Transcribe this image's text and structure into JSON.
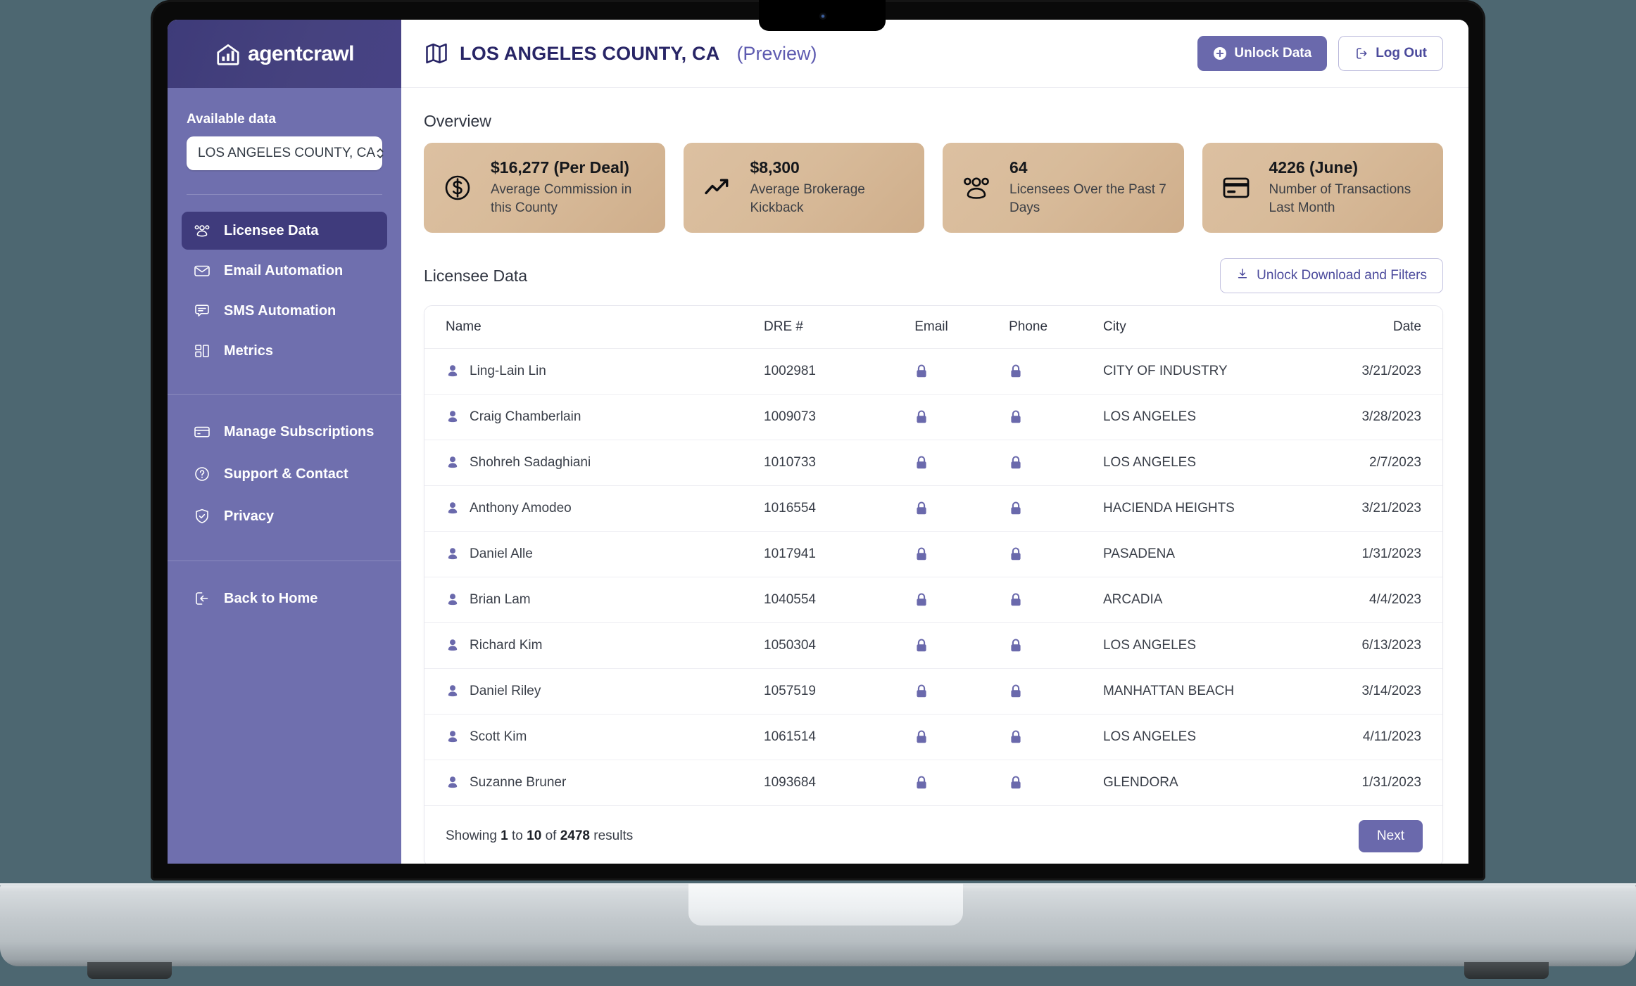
{
  "brand": {
    "name": "agentcrawl",
    "logo_icon": "building-chart-icon"
  },
  "sidebar": {
    "available_label": "Available data",
    "select_value": "LOS ANGELES COUNTY, CA",
    "select_icon": "chevron-updown-icon",
    "nav_primary": [
      {
        "label": "Licensee Data",
        "icon": "users-group-icon",
        "active": true
      },
      {
        "label": "Email Automation",
        "icon": "envelope-icon",
        "active": false
      },
      {
        "label": "SMS Automation",
        "icon": "chat-bubble-icon",
        "active": false
      },
      {
        "label": "Metrics",
        "icon": "layout-blocks-icon",
        "active": false
      }
    ],
    "nav_secondary": [
      {
        "label": "Manage Subscriptions",
        "icon": "credit-card-icon"
      },
      {
        "label": "Support & Contact",
        "icon": "question-circle-icon"
      },
      {
        "label": "Privacy",
        "icon": "shield-check-icon"
      }
    ],
    "nav_footer": [
      {
        "label": "Back to Home",
        "icon": "logout-arrow-icon"
      }
    ]
  },
  "header": {
    "map_icon": "map-icon",
    "title": "LOS ANGELES COUNTY, CA",
    "subtitle": "(Preview)",
    "unlock_label": "Unlock Data",
    "unlock_icon": "plus-circle-icon",
    "logout_label": "Log Out",
    "logout_icon": "logout-icon"
  },
  "overview": {
    "section_title": "Overview",
    "cards": [
      {
        "icon": "dollar-circle-icon",
        "value": "$16,277 (Per Deal)",
        "label": "Average Commission in this County"
      },
      {
        "icon": "trend-up-icon",
        "value": "$8,300",
        "label": "Average Brokerage Kickback"
      },
      {
        "icon": "users-group-icon",
        "value": "64",
        "label": "Licensees Over the Past 7 Days"
      },
      {
        "icon": "credit-card-icon",
        "value": "4226 (June)",
        "label": "Number of Transactions Last Month"
      }
    ]
  },
  "table_section": {
    "title": "Licensee Data",
    "unlock_button": {
      "label": "Unlock Download and Filters",
      "icon": "download-icon"
    },
    "columns": [
      "Name",
      "DRE #",
      "Email",
      "Phone",
      "City",
      "Date"
    ],
    "locked_icon": "lock-icon",
    "row_icon": "person-icon",
    "rows": [
      {
        "name": "Ling-Lain Lin",
        "dre": "1002981",
        "email": "locked",
        "phone": "locked",
        "city": "CITY OF INDUSTRY",
        "date": "3/21/2023"
      },
      {
        "name": "Craig Chamberlain",
        "dre": "1009073",
        "email": "locked",
        "phone": "locked",
        "city": "LOS ANGELES",
        "date": "3/28/2023"
      },
      {
        "name": "Shohreh Sadaghiani",
        "dre": "1010733",
        "email": "locked",
        "phone": "locked",
        "city": "LOS ANGELES",
        "date": "2/7/2023"
      },
      {
        "name": "Anthony Amodeo",
        "dre": "1016554",
        "email": "locked",
        "phone": "locked",
        "city": "HACIENDA HEIGHTS",
        "date": "3/21/2023"
      },
      {
        "name": "Daniel Alle",
        "dre": "1017941",
        "email": "locked",
        "phone": "locked",
        "city": "PASADENA",
        "date": "1/31/2023"
      },
      {
        "name": "Brian Lam",
        "dre": "1040554",
        "email": "locked",
        "phone": "locked",
        "city": "ARCADIA",
        "date": "4/4/2023"
      },
      {
        "name": "Richard Kim",
        "dre": "1050304",
        "email": "locked",
        "phone": "locked",
        "city": "LOS ANGELES",
        "date": "6/13/2023"
      },
      {
        "name": "Daniel Riley",
        "dre": "1057519",
        "email": "locked",
        "phone": "locked",
        "city": "MANHATTAN BEACH",
        "date": "3/14/2023"
      },
      {
        "name": "Scott Kim",
        "dre": "1061514",
        "email": "locked",
        "phone": "locked",
        "city": "LOS ANGELES",
        "date": "4/11/2023"
      },
      {
        "name": "Suzanne Bruner",
        "dre": "1093684",
        "email": "locked",
        "phone": "locked",
        "city": "GLENDORA",
        "date": "1/31/2023"
      }
    ],
    "footer": {
      "showing_prefix": "Showing ",
      "range_start": "1",
      "showing_mid": " to ",
      "range_end": "10",
      "showing_of": " of ",
      "total": "2478",
      "showing_suffix": " results",
      "next_label": "Next"
    }
  },
  "colors": {
    "sidebar_bg": "#6f6fae",
    "sidebar_active": "#3f3b7c",
    "logo_bg": "#3e3b79",
    "accent_purple": "#6a69ac",
    "title_navy": "#282566",
    "card_tan": "#dcc0a1",
    "lock_purple": "#6a69ac",
    "desktop_bg": "#4d6771"
  }
}
